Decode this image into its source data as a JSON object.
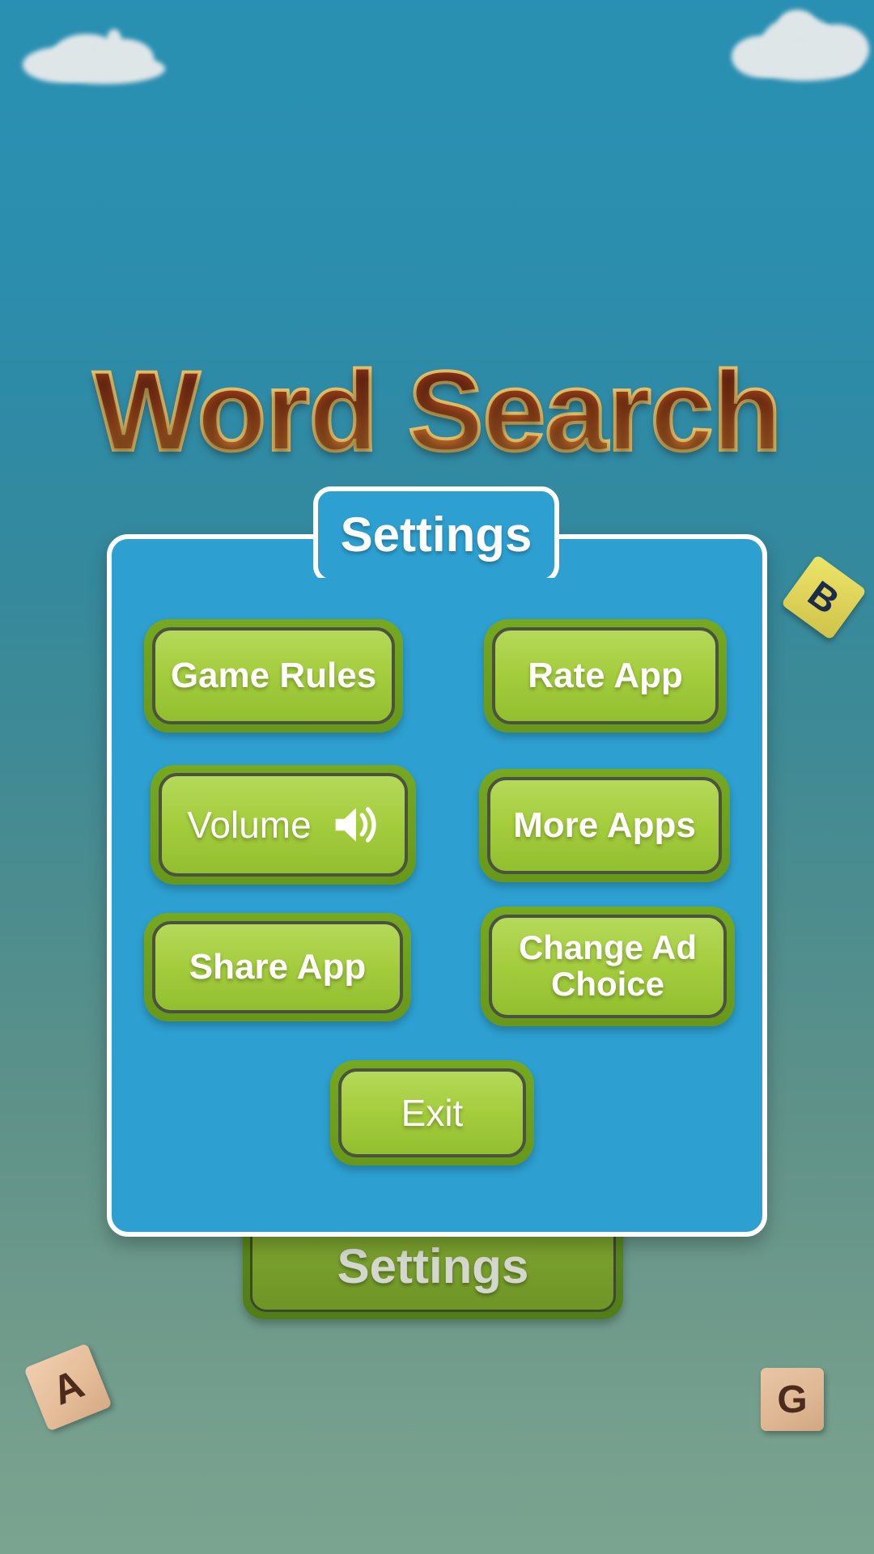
{
  "app": {
    "title": "Word Search"
  },
  "background": {
    "settings_button_label": "Settings",
    "sky_top_color": "#2a90b3",
    "sky_bottom_color": "#7aa490"
  },
  "decor_tiles": [
    {
      "letter": "B",
      "color": "#ddd257",
      "text_color": "#1d2b4a"
    },
    {
      "letter": "A",
      "color": "#e5bd99",
      "text_color": "#4c2a1c"
    },
    {
      "letter": "G",
      "color": "#dfb894",
      "text_color": "#4c2a1c"
    }
  ],
  "clouds": [
    {
      "name": "cloud-left"
    },
    {
      "name": "cloud-right"
    }
  ],
  "dialog": {
    "tab_title": "Settings",
    "panel_color": "#2da0d1",
    "border_color": "#ffffff",
    "buttons": [
      {
        "id": "game-rules",
        "label": "Game Rules",
        "icon": null
      },
      {
        "id": "rate-app",
        "label": "Rate App",
        "icon": null
      },
      {
        "id": "volume",
        "label": "Volume",
        "icon": "speaker-icon"
      },
      {
        "id": "more-apps",
        "label": "More Apps",
        "icon": null
      },
      {
        "id": "share-app",
        "label": "Share App",
        "icon": null
      },
      {
        "id": "change-ad",
        "label": "Change Ad\nChoice",
        "icon": null
      },
      {
        "id": "exit",
        "label": "Exit",
        "icon": null
      }
    ],
    "button_face_color": "#a6ce3f",
    "button_frame_color": "#6f9e1d"
  }
}
